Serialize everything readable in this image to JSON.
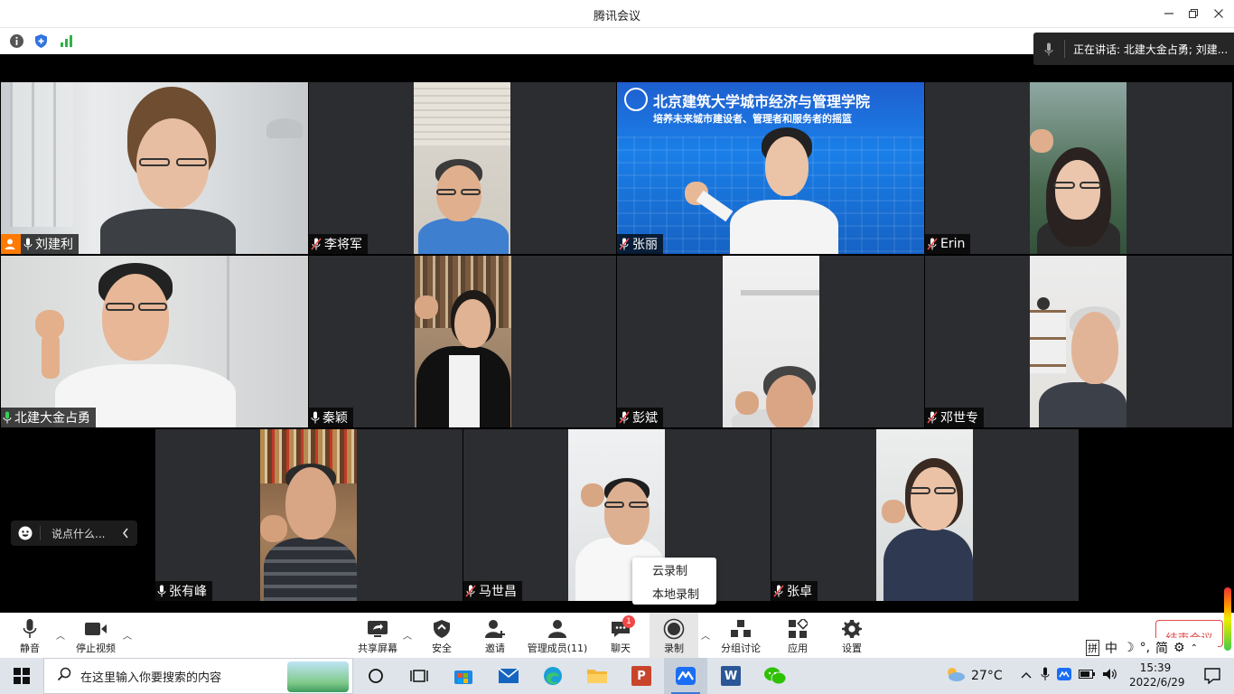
{
  "window": {
    "title": "腾讯会议"
  },
  "speaking": {
    "text": "正在讲话: 北建大金占勇; 刘建..."
  },
  "participants": [
    {
      "name": "刘建利"
    },
    {
      "name": "李将军"
    },
    {
      "name": "张丽"
    },
    {
      "name": "Erin"
    },
    {
      "name": "北建大金占勇"
    },
    {
      "name": "秦颖"
    },
    {
      "name": "彭斌"
    },
    {
      "name": "邓世专"
    },
    {
      "name": "张有峰"
    },
    {
      "name": "马世昌"
    },
    {
      "name": "张卓"
    }
  ],
  "banner": {
    "line1": "北京建筑大学城市经济与管理学院",
    "line2": "培养未来城市建设者、管理者和服务者的摇篮"
  },
  "chat": {
    "placeholder": "说点什么..."
  },
  "record_menu": {
    "cloud": "云录制",
    "local": "本地录制"
  },
  "toolbar": {
    "mute": "静音",
    "stop_video": "停止视频",
    "share": "共享屏幕",
    "security": "安全",
    "invite": "邀请",
    "members": "管理成员(11)",
    "chat": "聊天",
    "chat_badge": "1",
    "record": "录制",
    "breakout": "分组讨论",
    "apps": "应用",
    "settings": "设置",
    "end": "结束会议"
  },
  "ime": {
    "a": "拼",
    "b": "中",
    "c": "°,",
    "d": "简"
  },
  "taskbar": {
    "search_placeholder": "在这里输入你要搜索的内容",
    "weather": "27°C",
    "time": "15:39",
    "date": "2022/6/29",
    "ppt_letter": "P",
    "word_letter": "W"
  },
  "colors": {
    "active_border": "#2fbf4f",
    "accent": "#3a78d8",
    "danger": "#e34b4b",
    "host": "#ff7a00"
  }
}
